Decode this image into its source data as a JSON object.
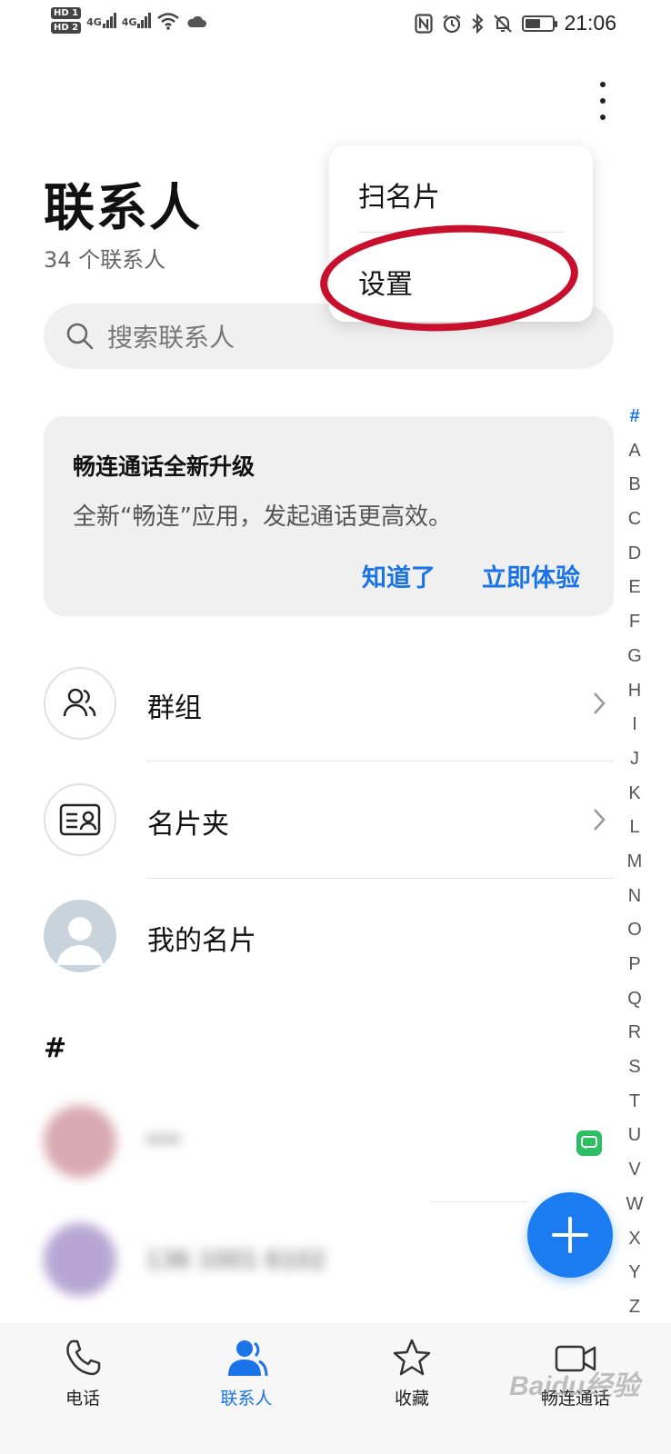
{
  "status_bar": {
    "sim1": "HD 1",
    "sim2": "HD 2",
    "net1": "4G",
    "net2": "4G",
    "time": "21:06",
    "icons": [
      "nfc-icon",
      "alarm-icon",
      "bluetooth-icon",
      "mute-icon",
      "battery-icon"
    ],
    "battery_level": 0.55
  },
  "header": {
    "title": "联系人",
    "subtitle": "34 个联系人"
  },
  "search": {
    "placeholder": "搜索联系人"
  },
  "popup_menu": {
    "items": [
      "扫名片",
      "设置"
    ],
    "highlighted": "设置"
  },
  "notice": {
    "title": "畅连通话全新升级",
    "description": "全新“畅连”应用，发起通话更高效。",
    "dismiss": "知道了",
    "try_now": "立即体验"
  },
  "list": {
    "groups": "群组",
    "cards": "名片夹",
    "my_card": "我的名片",
    "section": "#",
    "contacts": [
      {
        "name": "***"
      },
      {
        "name": "136 1001 6102"
      }
    ]
  },
  "alpha_index": [
    "#",
    "A",
    "B",
    "C",
    "D",
    "E",
    "F",
    "G",
    "H",
    "I",
    "J",
    "K",
    "L",
    "M",
    "N",
    "O",
    "P",
    "Q",
    "R",
    "S",
    "T",
    "U",
    "V",
    "W",
    "X",
    "Y",
    "Z"
  ],
  "bottom_nav": {
    "tabs": [
      {
        "label": "电话",
        "icon": "phone-icon"
      },
      {
        "label": "联系人",
        "icon": "contacts-icon",
        "active": true
      },
      {
        "label": "收藏",
        "icon": "star-icon"
      },
      {
        "label": "畅连通话",
        "icon": "video-call-icon"
      }
    ]
  },
  "watermark": "Baidu经验",
  "colors": {
    "accent": "#1a73e8",
    "fab": "#1a7cf0",
    "highlight_ring": "#c8102e"
  }
}
